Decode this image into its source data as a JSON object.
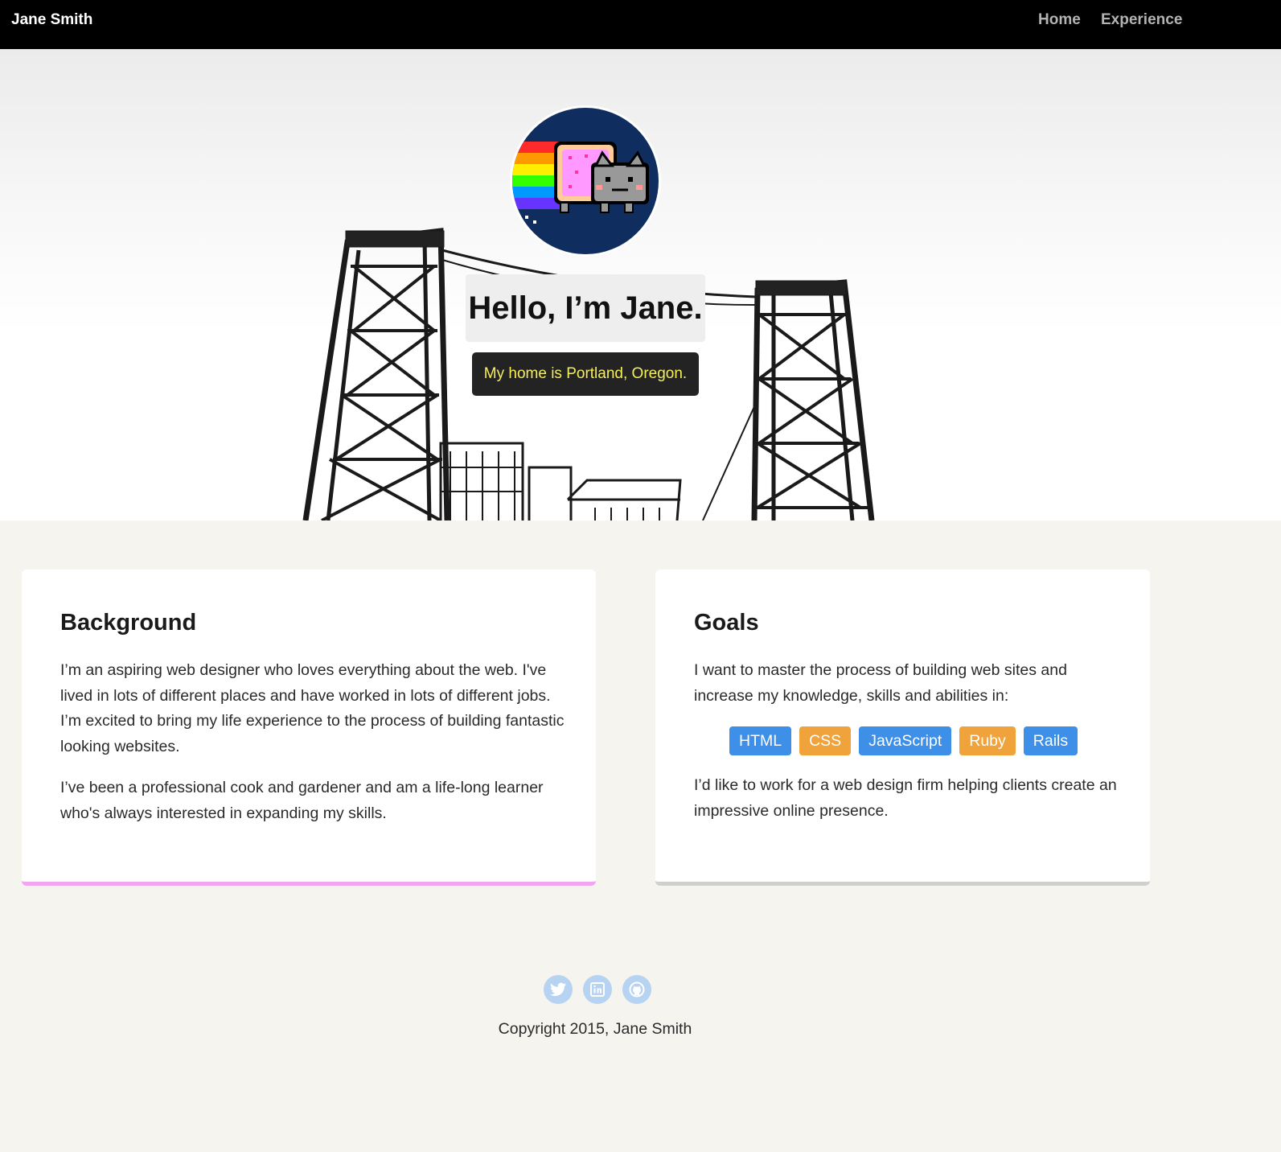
{
  "nav": {
    "brand": "Jane Smith",
    "links": [
      "Home",
      "Experience"
    ]
  },
  "hero": {
    "title": "Hello, I’m Jane.",
    "subtitle": "My home is Portland, Oregon.",
    "avatar_icon": "nyan-cat-icon"
  },
  "background": {
    "heading": "Background",
    "paragraphs": [
      "I’m an aspiring web designer who loves everything about the web. I've lived in lots of different places and have worked in lots of different jobs. I’m excited to bring my life experience to the process of building fantastic looking websites.",
      "I’ve been a professional cook and gardener and am a life-long learner who's always interested in expanding my skills."
    ]
  },
  "goals": {
    "heading": "Goals",
    "intro": "I want to master the process of building web sites and increase my knowledge, skills and abilities in:",
    "skills": [
      "HTML",
      "CSS",
      "JavaScript",
      "Ruby",
      "Rails"
    ],
    "outro": "I’d like to work for a web design firm helping clients create an impressive online presence."
  },
  "footer": {
    "social_icons": [
      "twitter-icon",
      "linkedin-icon",
      "github-icon"
    ],
    "copyright": "Copyright 2015, Jane Smith"
  },
  "colors": {
    "nav_bg": "#000000",
    "subtitle_text": "#f5ee5a",
    "tag_blue": "#3d8fe8",
    "tag_orange": "#f0a23b",
    "background_card_border": "#f0a5ee",
    "goals_card_border": "#cfcfcc",
    "social_icon_bg": "#b7d3f2",
    "page_bg": "#f5f4ef"
  }
}
